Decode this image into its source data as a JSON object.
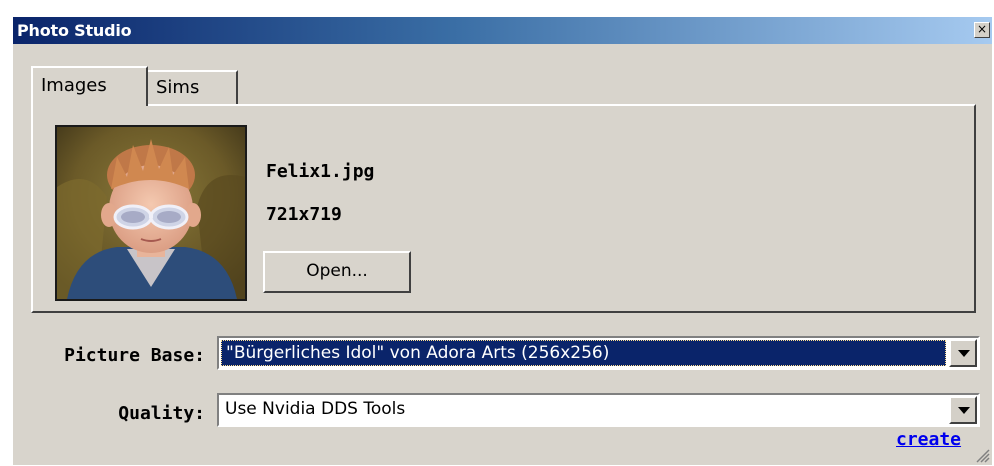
{
  "window": {
    "title": "Photo Studio",
    "close_glyph": "×"
  },
  "tabs": [
    {
      "label": "Images",
      "active": true
    },
    {
      "label": "Sims",
      "active": false
    }
  ],
  "image_panel": {
    "filename": "Felix1.jpg",
    "dimensions": "721x719",
    "open_button": "Open..."
  },
  "form": {
    "picture_base": {
      "label": "Picture Base:",
      "value": "\"Bürgerliches Idol\" von Adora Arts (256x256)"
    },
    "quality": {
      "label": "Quality:",
      "value": "Use Nvidia DDS Tools"
    }
  },
  "create_link": "create",
  "colors": {
    "titlebar_start": "#0a246a",
    "titlebar_end": "#a6caf0",
    "selection": "#0a246a",
    "link": "#0000ee",
    "window_bg": "#d8d4cc"
  }
}
